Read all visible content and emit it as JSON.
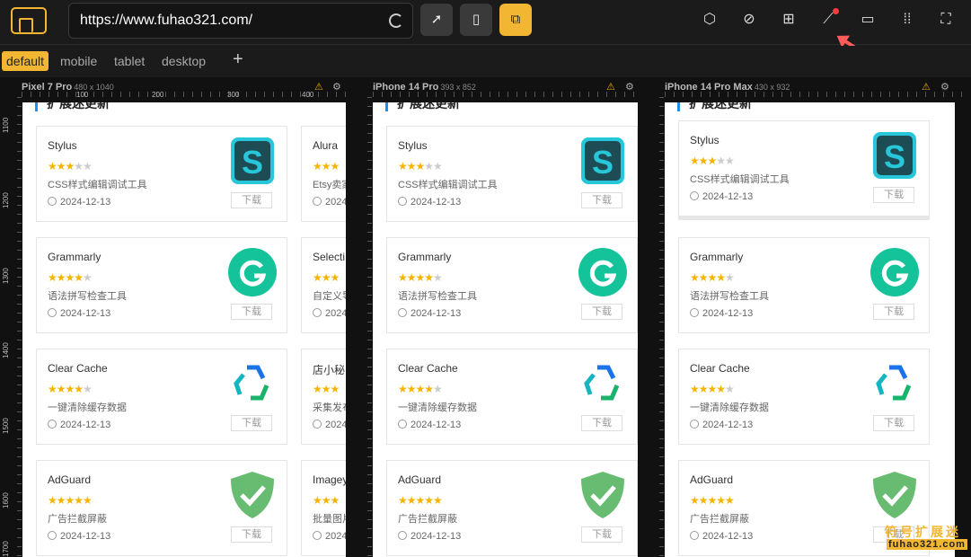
{
  "address_bar": {
    "url": "https://www.fuhao321.com/"
  },
  "toolbar": {
    "buttons": [
      {
        "icon": "pointer-icon"
      },
      {
        "icon": "phone-icon"
      },
      {
        "icon": "responsive-icon",
        "active": true
      }
    ],
    "right_icons": [
      "cube-icon",
      "overlap-icon",
      "grid-icon",
      "ruler-icon",
      "minus-line-icon",
      "dots-grid-icon",
      "fullscreen-icon"
    ]
  },
  "tabs": [
    {
      "label": "default",
      "active": true
    },
    {
      "label": "mobile"
    },
    {
      "label": "tablet"
    },
    {
      "label": "desktop"
    },
    {
      "label": "+"
    }
  ],
  "devices": [
    {
      "name": "Pixel 7 Pro",
      "size": "480 x 1040"
    },
    {
      "name": "iPhone 14 Pro",
      "size": "393 x 852"
    },
    {
      "name": "iPhone 14 Pro Max",
      "size": "430 x 932"
    }
  ],
  "ruler_marks": {
    "top": [
      "100",
      "200",
      "300",
      "400"
    ],
    "left": [
      "1100",
      "1200",
      "1300",
      "1400",
      "1500",
      "1600",
      "1700"
    ]
  },
  "section_title": "扩展迷更新",
  "cards": [
    {
      "name": "Stylus",
      "stars": 3,
      "desc": "CSS样式编辑调试工具",
      "date": "2024-12-13",
      "icon": "stylus-icon",
      "download": "下载"
    },
    {
      "name": "Grammarly",
      "stars": 4,
      "desc": "语法拼写检查工具",
      "date": "2024-12-13",
      "icon": "grammarly-icon",
      "download": "下载"
    },
    {
      "name": "Clear Cache",
      "stars": 4,
      "desc": "一键清除缓存数据",
      "date": "2024-12-13",
      "icon": "recycle-icon",
      "download": "下载"
    },
    {
      "name": "AdGuard",
      "stars": 5,
      "desc": "广告拦截屏蔽",
      "date": "2024-12-13",
      "icon": "shield-check-icon",
      "download": "下载"
    }
  ],
  "partial_cards": [
    {
      "name": "Alura",
      "desc": "Etsy卖家",
      "date": "2024"
    },
    {
      "name": "Selecti",
      "desc": "自定义导",
      "date": "2024"
    },
    {
      "name": "店小秘",
      "desc": "采集发布",
      "date": "2024"
    },
    {
      "name": "Imagey",
      "desc": "批量图片",
      "date": "2024"
    }
  ],
  "watermark": {
    "line1": "符号扩展迷",
    "line2": "fuhao321.com"
  },
  "colors": {
    "accent": "#f2b632",
    "star": "#f5b400",
    "stylus": "#27c6d9",
    "grammarly": "#15c39a",
    "adguard": "#68bc71"
  }
}
